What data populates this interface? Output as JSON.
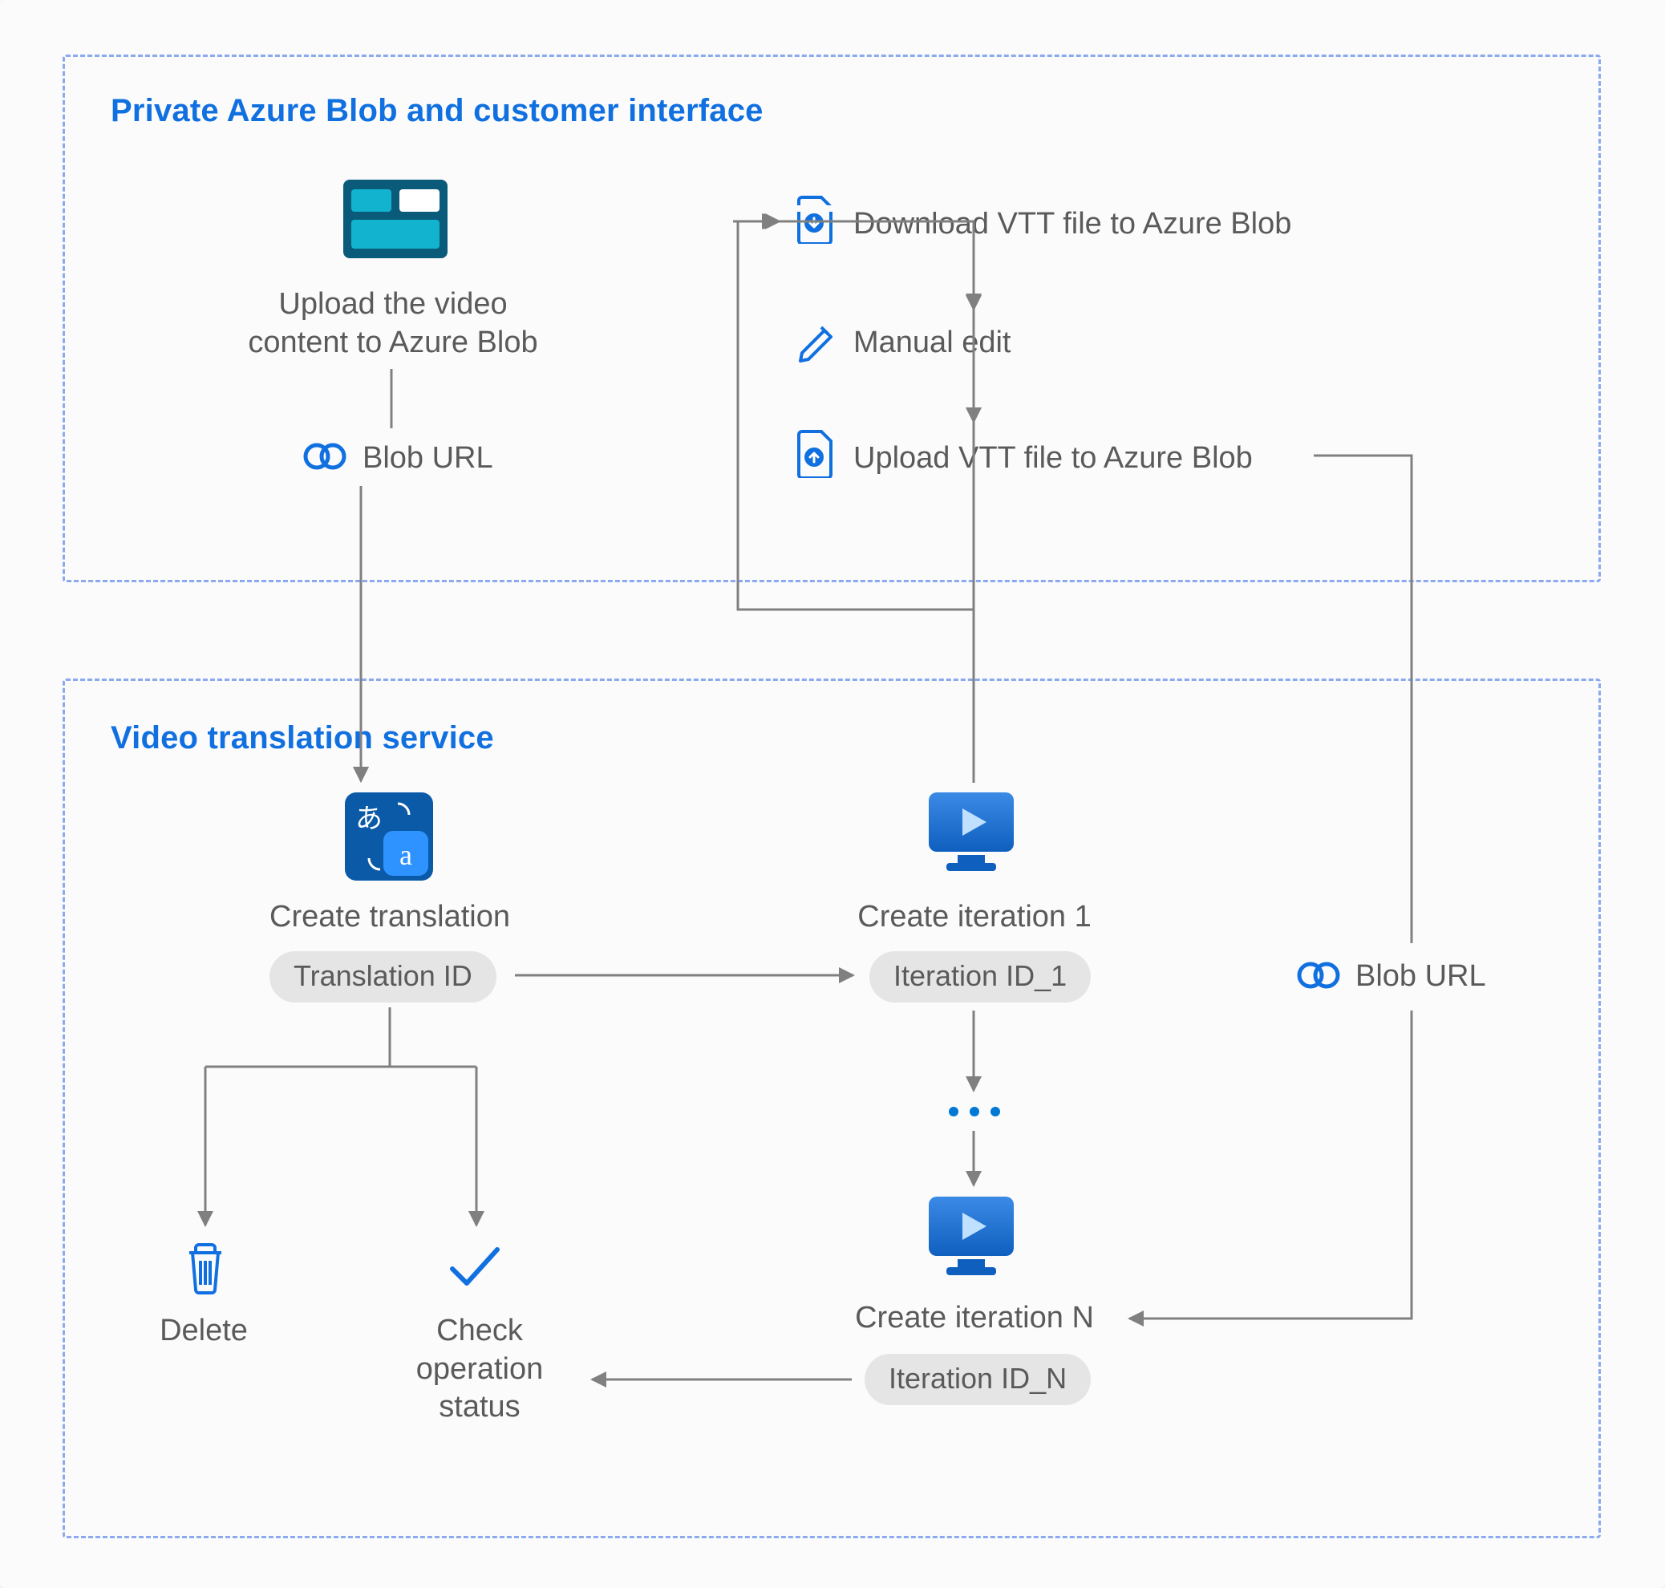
{
  "sections": {
    "top": {
      "title": "Private Azure Blob and customer interface"
    },
    "bottom": {
      "title": "Video translation service"
    }
  },
  "top": {
    "upload_text": "Upload the video\ncontent to Azure Blob",
    "blob_url_label": "Blob URL",
    "download_vtt": "Download VTT file to Azure Blob",
    "manual_edit": "Manual edit",
    "upload_vtt": "Upload VTT file to Azure Blob"
  },
  "bottom": {
    "create_translation": "Create translation",
    "translation_id": "Translation ID",
    "delete": "Delete",
    "check_status": "Check\noperation\nstatus",
    "create_iter1": "Create iteration 1",
    "iter1_id": "Iteration ID_1",
    "create_iterN": "Create iteration N",
    "iterN_id": "Iteration ID_N",
    "blob_url_label": "Blob URL"
  }
}
